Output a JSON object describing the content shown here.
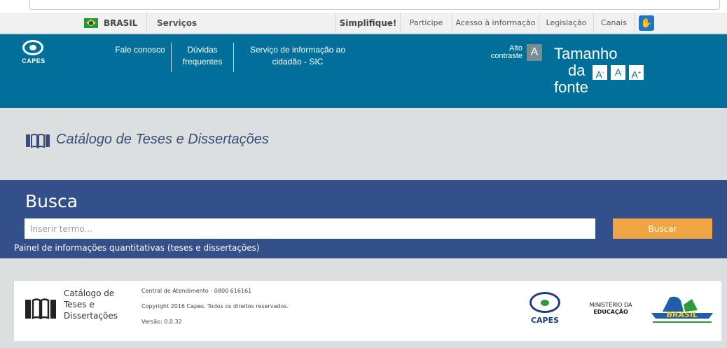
{
  "gov_bar": {
    "brasil": "BRASIL",
    "servicos": "Serviços",
    "simplifique": "Simplifique!",
    "participe": "Participe",
    "acesso": "Acesso à informação",
    "legislacao": "Legislação",
    "canais": "Canais"
  },
  "header": {
    "logo_text": "CAPES",
    "links": {
      "fale": "Fale conosco",
      "duvidas_1": "Dúvidas",
      "duvidas_2": "frequentes",
      "sic_1": "Serviço de informação ao",
      "sic_2": "cidadão - SIC"
    },
    "contraste_1": "Alto",
    "contraste_2": "contraste",
    "contraste_button": "A",
    "tamanho_1": "Tamanho",
    "tamanho_2": "da",
    "tamanho_3": "fonte",
    "font_dec": "A",
    "font_dec_sup": "-",
    "font_normal": "A",
    "font_inc": "A",
    "font_inc_sup": "+"
  },
  "title": "Catálogo de Teses e Dissertações",
  "search": {
    "heading": "Busca",
    "placeholder": "Inserir termo...",
    "button": "Buscar",
    "painel_link": "Painel de informações quantitativas (teses e dissertações)"
  },
  "footer": {
    "name_1": "Catálogo de",
    "name_2": "Teses e",
    "name_3": "Dissertações",
    "central": "Central de Atendimento - 0800 616161",
    "copyright": "Copyright 2016 Capes. Todos os direitos reservados.",
    "versao": "Versão: 0.0.32",
    "capes_logo": "CAPES",
    "mec_1": "MINISTÉRIO DA",
    "mec_2": "EDUCAÇÃO",
    "gov_logo": "BRASIL"
  },
  "colors": {
    "header_blue": "#00709a",
    "search_blue": "#34508b",
    "button_orange": "#f0a544"
  },
  "icons": {
    "book": "book-icon",
    "flag": "brazil-flag-icon",
    "vlibras": "vlibras-icon"
  }
}
